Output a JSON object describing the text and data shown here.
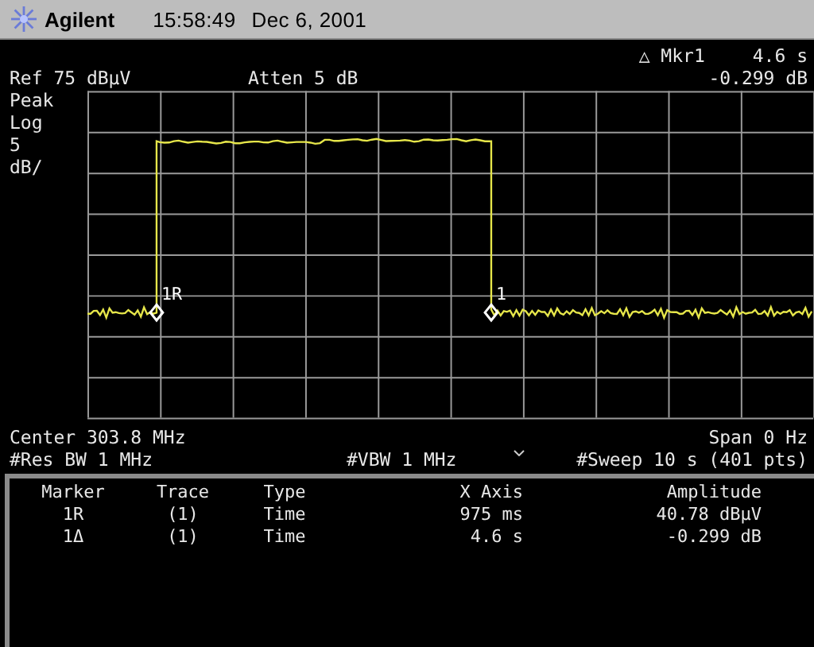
{
  "header": {
    "brand": "Agilent",
    "time": "15:58:49",
    "date": "Dec 6, 2001"
  },
  "marker_readout": {
    "label": "△ Mkr1",
    "x_value": "4.6 s",
    "y_value": "-0.299 dB"
  },
  "settings": {
    "ref": "Ref 75 dBμV",
    "atten": "Atten 5 dB"
  },
  "scale": [
    "Peak",
    "Log",
    "5",
    "dB/"
  ],
  "trace_markers": [
    {
      "label": "1R"
    },
    {
      "label": "1"
    }
  ],
  "footer": {
    "center": "Center 303.8 MHz",
    "span": "Span 0 Hz",
    "res_bw": "#Res BW 1 MHz",
    "vbw": "#VBW 1 MHz",
    "sweep": "#Sweep 10 s (401 pts)"
  },
  "marker_table": {
    "columns": [
      "Marker",
      "Trace",
      "Type",
      "X Axis",
      "Amplitude"
    ],
    "rows": [
      [
        "1R",
        "(1)",
        "Time",
        "975 ms",
        "40.78 dBμV"
      ],
      [
        "1Δ",
        "(1)",
        "Time",
        "4.6 s",
        "-0.299 dB"
      ]
    ]
  }
}
